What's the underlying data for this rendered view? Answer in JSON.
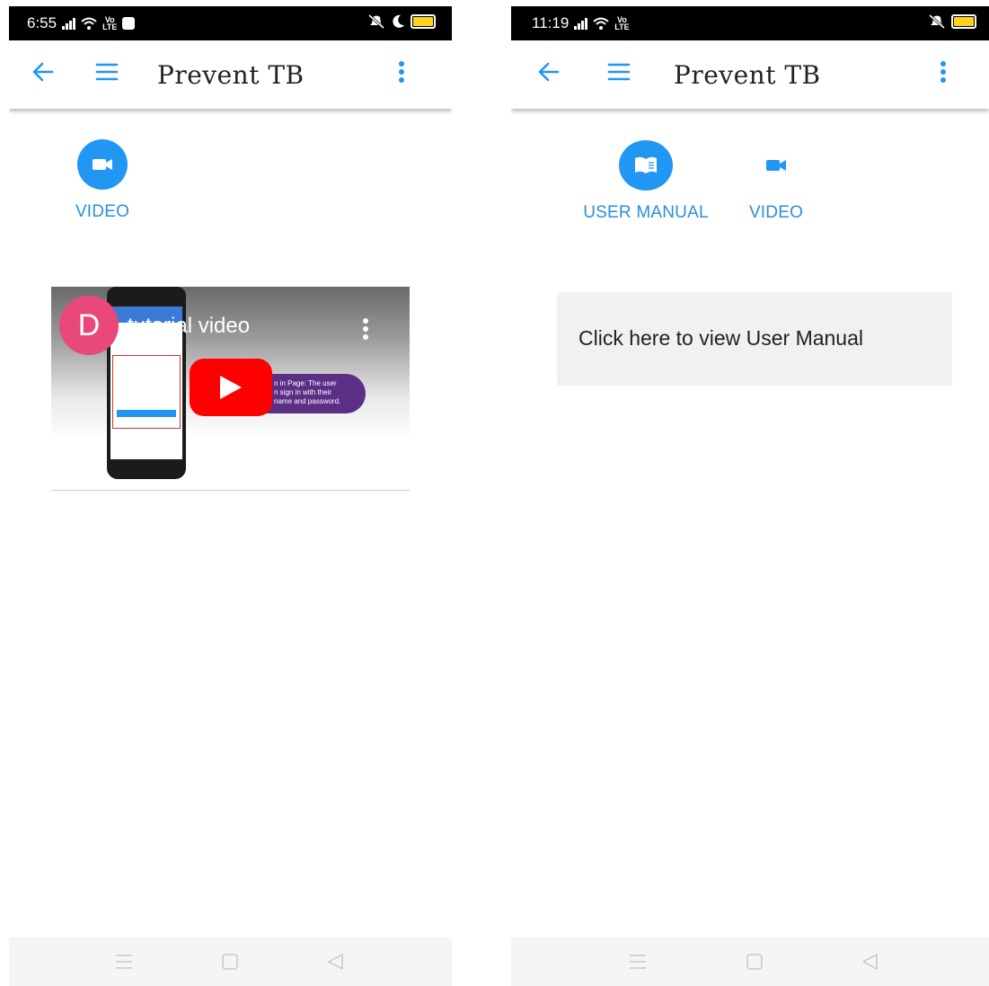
{
  "left_screen": {
    "status": {
      "time": "6:55",
      "volte": "Vo\nLTE"
    },
    "app_bar": {
      "title": "Prevent TB"
    },
    "tabs": [
      {
        "label": "VIDEO",
        "icon": "video-camera-icon"
      }
    ],
    "video": {
      "channel_initial": "D",
      "title": "tutorial video",
      "overlay_text": "n in Page: The user\nn sign in with their\nname and password."
    }
  },
  "right_screen": {
    "status": {
      "time": "11:19",
      "volte": "Vo\nLTE"
    },
    "app_bar": {
      "title": "Prevent TB"
    },
    "tabs": [
      {
        "label": "USER MANUAL",
        "icon": "book-icon"
      },
      {
        "label": "VIDEO",
        "icon": "video-camera-icon"
      }
    ],
    "manual_card": {
      "text": "Click here to view User Manual"
    }
  },
  "colors": {
    "accent": "#2196f3",
    "label": "#2a8fd8",
    "avatar": "#e8497a",
    "youtube": "#ff0000",
    "pill": "#5b2f86"
  }
}
